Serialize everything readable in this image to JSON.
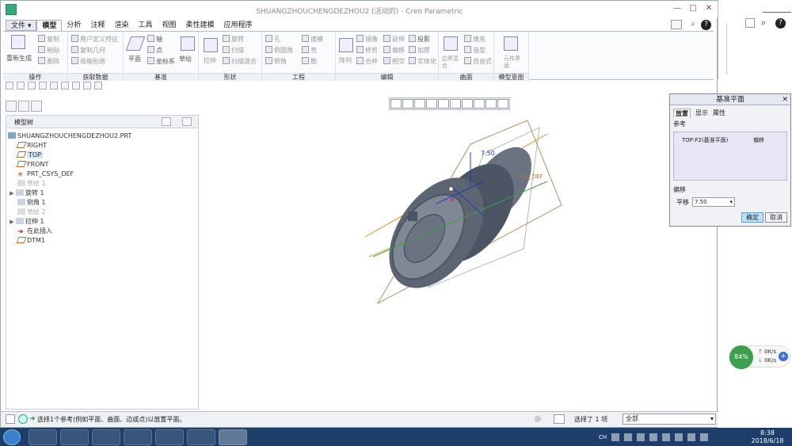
{
  "window": {
    "title": "SHUANGZHOUCHENGDEZHOU2 (活动的) - Creo Parametric",
    "min": "—",
    "max": "□",
    "close": "✕"
  },
  "menu": {
    "file": "文件",
    "tabs": [
      "模型",
      "分析",
      "注释",
      "渲染",
      "工具",
      "视图",
      "柔性建模",
      "应用程序"
    ]
  },
  "ribbon": {
    "ops": {
      "regen": "重新生成",
      "copy": "复制",
      "paste": "粘贴",
      "delete": "删除",
      "label": "操作"
    },
    "getdata": {
      "udf": "用户定义特征",
      "copygeom": "复制几何",
      "shrinkwrap": "收缩包络",
      "label": "获取数据"
    },
    "datum": {
      "plane": "平面",
      "axis": "轴",
      "point": "点",
      "csys": "坐标系",
      "sketch": "草绘",
      "label": "基准"
    },
    "shape": {
      "extrude": "拉伸",
      "revolve": "旋转",
      "sweep": "扫描",
      "sweptblend": "扫描混合",
      "label": "形状"
    },
    "eng": {
      "hole": "孔",
      "round": "倒圆角",
      "chamfer": "倒角",
      "draft": "拔模",
      "shell": "壳",
      "rib": "筋",
      "label": "工程"
    },
    "edit": {
      "pattern": "阵列",
      "mirror": "镜像",
      "extend": "延伸",
      "project": "投影",
      "trim": "修剪",
      "offset": "偏移",
      "thicken": "加厚",
      "merge": "合并",
      "intersect": "相交",
      "solidify": "实体化",
      "label": "编辑"
    },
    "surface": {
      "boundary": "边界混合",
      "fill": "填充",
      "style": "造型",
      "freestyle": "自由式",
      "label": "曲面"
    },
    "intent": {
      "component": "元件界面",
      "label": "模型意图"
    }
  },
  "tree": {
    "header": "模型树",
    "items": [
      {
        "label": "SHUANGZHOUCHENGDEZHOU2.PRT",
        "type": "part"
      },
      {
        "label": "RIGHT",
        "type": "plane"
      },
      {
        "label": "TOP",
        "type": "plane"
      },
      {
        "label": "FRONT",
        "type": "plane"
      },
      {
        "label": "PRT_CSYS_DEF",
        "type": "csys"
      },
      {
        "label": "草绘 1",
        "type": "sketch"
      },
      {
        "label": "旋转 1",
        "type": "revolve"
      },
      {
        "label": "倒角 1",
        "type": "chamfer"
      },
      {
        "label": "草绘 2",
        "type": "sketch"
      },
      {
        "label": "拉伸 1",
        "type": "extrude"
      },
      {
        "label": "在此插入",
        "type": "insert"
      },
      {
        "label": "DTM1",
        "type": "plane"
      }
    ]
  },
  "viewport": {
    "dimension": "7.50",
    "csys_label": "SYS_DEF"
  },
  "dialog": {
    "title": "基准平面",
    "tabs": [
      "放置",
      "显示",
      "属性"
    ],
    "ref_label": "参考",
    "ref_item": "TOP:F2(基准平面)",
    "ref_type": "偏移",
    "offset_label": "偏移",
    "translate_label": "平移",
    "translate_value": "7.50",
    "ok": "确定",
    "cancel": "取消"
  },
  "status": {
    "message": "选择1个参考(例如平面、曲面、边或点)以放置平面。",
    "selected": "选择了 1 项",
    "filter": "全部"
  },
  "net": {
    "percent": "84%",
    "up": "0K/s",
    "down": "0K/s"
  },
  "taskbar": {
    "lang": "CH",
    "time": "8:38",
    "date": "2018/6/18"
  },
  "colors": {
    "model": "#6b7280",
    "dim": "#1e3ab8",
    "plane_orange": "#e88a1a",
    "plane_green": "#3aa63a",
    "bbox": "#b0703a"
  }
}
